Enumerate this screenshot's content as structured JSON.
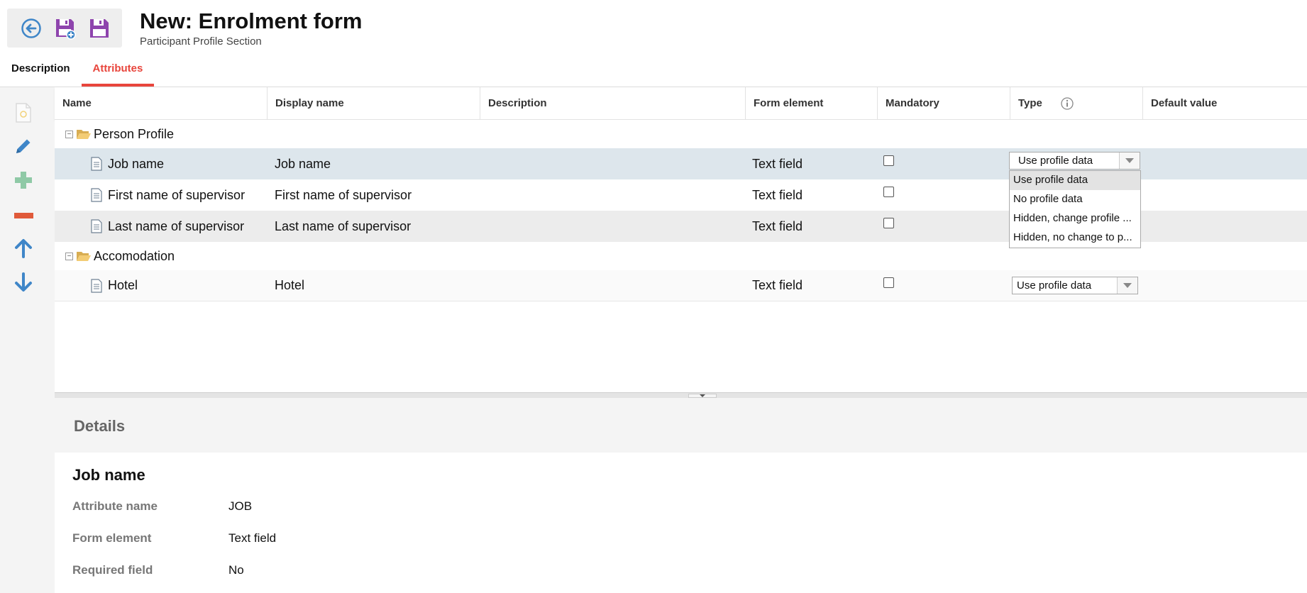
{
  "header": {
    "title": "New: Enrolment form",
    "subtitle": "Participant Profile Section"
  },
  "tabs": [
    {
      "label": "Description",
      "active": false
    },
    {
      "label": "Attributes",
      "active": true
    }
  ],
  "colors": {
    "accent": "#e8453c",
    "icon_blue": "#3f86c8",
    "icon_purple": "#8e44ad",
    "add_green": "#8fc9a6",
    "remove_red": "#e05a3a",
    "selected_row": "#dde6ec"
  },
  "grid": {
    "columns": [
      "Name",
      "Display name",
      "Description",
      "Form element",
      "Mandatory",
      "Type",
      "Default value"
    ],
    "groups": [
      {
        "name": "Person Profile",
        "rows": [
          {
            "name": "Job name",
            "display_name": "Job name",
            "form_element": "Text field",
            "mandatory": false,
            "type": "Use profile data",
            "selected": true
          },
          {
            "name": "First name of supervisor",
            "display_name": "First name of supervisor",
            "form_element": "Text field",
            "mandatory": false,
            "type": ""
          },
          {
            "name": "Last name of supervisor",
            "display_name": "Last name of supervisor",
            "form_element": "Text field",
            "mandatory": false,
            "type": ""
          }
        ]
      },
      {
        "name": "Accomodation",
        "rows": [
          {
            "name": "Hotel",
            "display_name": "Hotel",
            "form_element": "Text field",
            "mandatory": false,
            "type": "Use profile data"
          }
        ]
      }
    ],
    "type_options": [
      "Use profile data",
      "No profile data",
      "Hidden, change profile ...",
      "Hidden, no change to p..."
    ]
  },
  "details": {
    "section_title": "Details",
    "item_title": "Job name",
    "fields": [
      {
        "label": "Attribute name",
        "value": "JOB"
      },
      {
        "label": "Form element",
        "value": "Text field"
      },
      {
        "label": "Required field",
        "value": "No"
      }
    ]
  }
}
